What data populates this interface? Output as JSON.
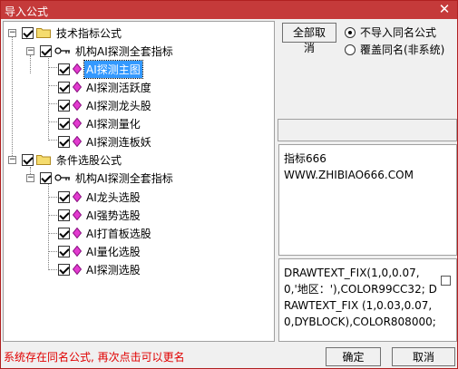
{
  "window": {
    "title": "导入公式",
    "close_glyph": "✕"
  },
  "tree": {
    "group1": {
      "label": "技术指标公式",
      "subgroup": {
        "label": "机构AI探测全套指标",
        "items": [
          "AI探测主图",
          "AI探测活跃度",
          "AI探测龙头股",
          "AI探测量化",
          "AI探测连板妖"
        ]
      }
    },
    "group2": {
      "label": "条件选股公式",
      "subgroup": {
        "label": "机构AI探测全套指标",
        "items": [
          "AI龙头选股",
          "AI强势选股",
          "AI打首板选股",
          "AI量化选股",
          "AI探测选股"
        ]
      }
    },
    "expander_glyph": "−"
  },
  "controls": {
    "cancel_all_label": "全部取消",
    "radio_options": [
      "不导入同名公式",
      "覆盖同名(非系统)"
    ],
    "selected_radio": 0
  },
  "info": {
    "line1": "指标666",
    "line2": "WWW.ZHIBIAO666.COM"
  },
  "formula": {
    "text": "DRAWTEXT_FIX(1,0,0.07,0,'地区：'),COLOR99CC32; DRAWTEXT_FIX (1,0.03,0.07,0,DYBLOCK),COLOR808000;"
  },
  "status": {
    "text": "系统存在同名公式, 再次点击可以更名"
  },
  "buttons": {
    "ok": "确定",
    "cancel": "取消"
  },
  "colors": {
    "titlebar": "#c53a3a",
    "status": "#e00000",
    "selection": "#3399ff"
  }
}
